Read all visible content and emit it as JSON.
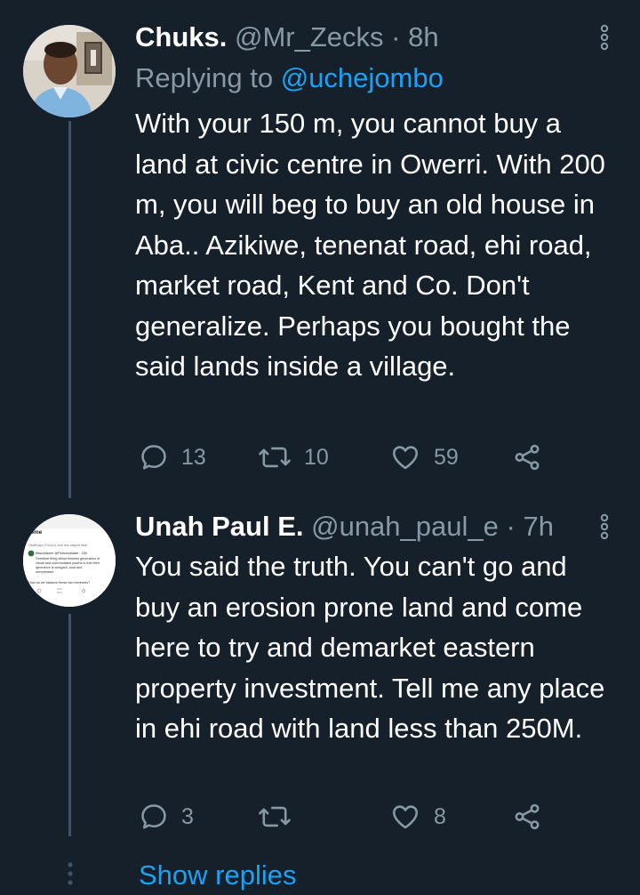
{
  "tweets": [
    {
      "display_name": "Chuks.",
      "handle": "@Mr_Zecks",
      "time": "8h",
      "replying_prefix": "Replying to",
      "replying_mention": "@uchejombo",
      "text": "With your 150 m, you cannot buy a land at civic centre in Owerri. With 200 m, you will beg to buy an old house in Aba.. Azikiwe, tenenat road, ehi road, market road, Kent and Co. Don't generalize. Perhaps you bought the said lands inside a village.",
      "replies": "13",
      "retweets": "10",
      "likes": "59"
    },
    {
      "display_name": "Unah Paul E.",
      "handle": "@unah_paul_e",
      "time": "7h",
      "text": "You said the truth. You can't go and buy an erosion prone land and come here to try and demarket eastern property investment. Tell me any place in ehi road with land less than 250M.",
      "replies": "3",
      "retweets": "",
      "likes": "8",
      "avatar_screenshot": {
        "title": "ome",
        "lines": [
          "Obafisayo Ehiud & and ass stayed faial",
          "tiflachideem @Plofcandidate · 18h",
          "Oneldest thing about thisnew generation of",
          "visual and commodated youths is that their",
          "ignorance is arrogant, loud and",
          "unrepentant",
          "How do we balance these two extremes?"
        ]
      }
    }
  ],
  "thread": {
    "show_replies": "Show replies"
  },
  "icons": {
    "reply": "reply-icon",
    "retweet": "retweet-icon",
    "like": "heart-icon",
    "share": "share-icon",
    "more": "more-vertical-icon"
  },
  "colors": {
    "background": "#15202b",
    "text": "#ffffff",
    "secondary": "#8899a6",
    "accent": "#1da1f2",
    "thread_line": "#3d5466"
  }
}
